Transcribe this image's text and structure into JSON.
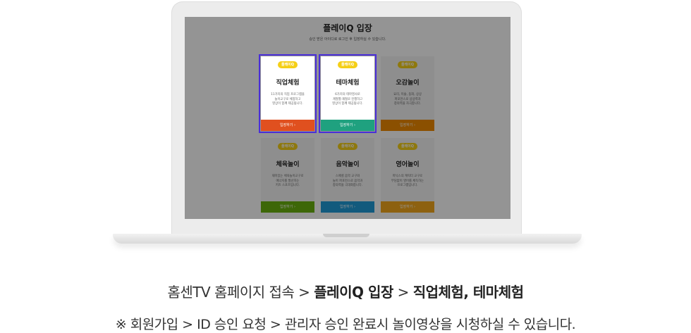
{
  "screen": {
    "title": "플레이Q 입장",
    "subtitle": "승인 받은 아이디로 로그인 후 입장하실 수 있습니다.",
    "cards": [
      {
        "logo": "플레이Q",
        "title": "직업체험",
        "desc": "11가지의 직업 프로그램을\n놀이교구로 체험하고\n영상이 함께 제공됩니다.",
        "button": "입장하기 ›",
        "btn_color": "#e0501f",
        "selected": true
      },
      {
        "logo": "플레이Q",
        "title": "테마체험",
        "desc": "6가지의 테마영사로\n계절별·재철로 진행하고\n영상이 함께 제공됩니다.",
        "button": "입장하기 ›",
        "btn_color": "#1fa17f",
        "selected": true
      },
      {
        "logo": "플레이Q",
        "title": "오감놀이",
        "desc": "요리, 미술, 동화, 상상\n퍼포먼스로 상상력과\n창의력을 자극합니다.",
        "button": "입장하기 ›",
        "btn_color": "#f08a00",
        "selected": false
      },
      {
        "logo": "플레이Q",
        "title": "체육놀이",
        "desc": "재미있는 체육놀이교구로\n에너지를 발산하는\n키즈 스포츠입니다.",
        "button": "입장하기 ›",
        "btn_color": "#6ab20f",
        "selected": false
      },
      {
        "logo": "플레이Q",
        "title": "음악놀이",
        "desc": "스페셜 음악 교구와\n놀이 퍼포먼스로 음악과\n창의력을 극대화합니다.",
        "button": "입장하기 ›",
        "btn_color": "#1f9bd8",
        "selected": false
      },
      {
        "logo": "플레이Q",
        "title": "영어놀이",
        "desc": "파닉스의 캐릭터 교구로\n부담없이 영어를 체득하는\n프로그램입니다.",
        "button": "입장하기 ›",
        "btn_color": "#f3a81c",
        "selected": false
      }
    ]
  },
  "caption": {
    "line1_prefix": "홈센TV 홈페이지 접속 > ",
    "line1_bold1": "플레이Q 입장",
    "line1_sep": " > ",
    "line1_bold2": "직업체험, 테마체험",
    "line2": "※ 회원가입 > ID 승인 요청 > 관리자 승인 완료시 놀이영상을 시청하실 수 있습니다."
  },
  "colors": {
    "selection": "#4a2fd8",
    "logo": "#f5cf17",
    "overlay": "rgba(0,0,0,0.42)"
  }
}
